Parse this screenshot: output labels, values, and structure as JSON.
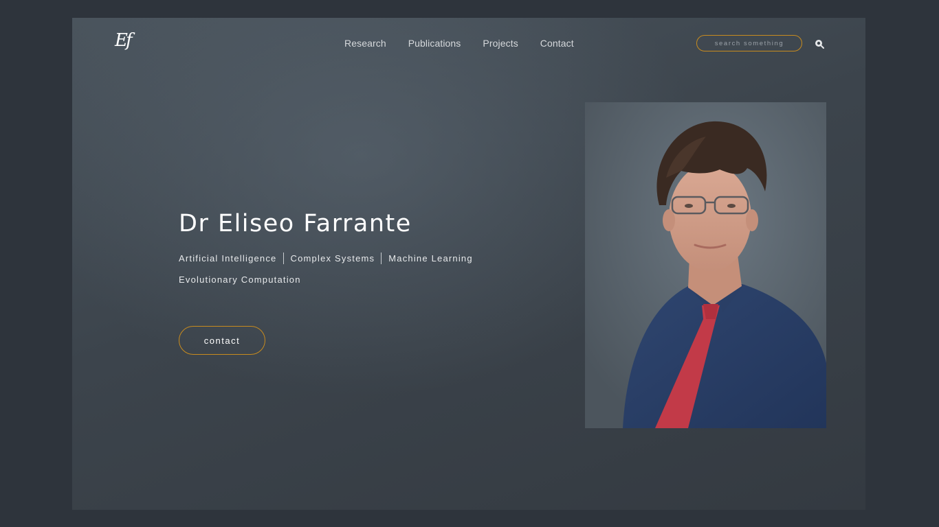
{
  "header": {
    "logo_text": "Ef",
    "nav": [
      {
        "label": "Research"
      },
      {
        "label": "Publications"
      },
      {
        "label": "Projects"
      },
      {
        "label": "Contact"
      }
    ],
    "search": {
      "placeholder": "search something",
      "icon": "search-icon",
      "accent_color": "#c98c1e"
    }
  },
  "hero": {
    "title": "Dr Eliseo Farrante",
    "tags": [
      "Artificial Intelligence",
      "Complex Systems",
      "Machine Learning",
      "Evolutionary Computation"
    ],
    "contact_label": "contact"
  },
  "portrait": {
    "icon": "portrait-photo"
  },
  "colors": {
    "page_bg": "#2e343c",
    "accent": "#c98c1e",
    "text": "#ffffff"
  }
}
